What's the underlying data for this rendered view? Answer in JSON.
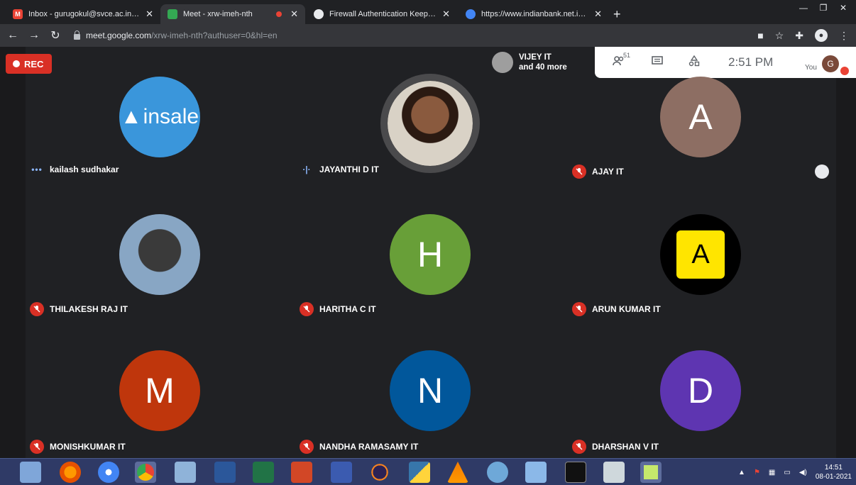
{
  "browser": {
    "tabs": [
      {
        "title": "Inbox - gurugokul@svce.ac.in - S",
        "favicon_color": "#ea4335",
        "active": false
      },
      {
        "title": "Meet - xrw-imeh-nth",
        "favicon_color": "#34a853",
        "active": true
      },
      {
        "title": "Firewall Authentication Keepalive",
        "favicon_color": "#e8eaed",
        "active": false
      },
      {
        "title": "https://www.indianbank.net.in/jsp",
        "favicon_color": "#4285f4",
        "active": false
      }
    ],
    "url_host": "meet.google.com",
    "url_path": "/xrw-imeh-nth?authuser=0&hl=en"
  },
  "meet": {
    "rec_label": "REC",
    "raised_hand_names": "VIJEY IT",
    "raised_hand_more": "and 40 more",
    "participants_count": "51",
    "clock": "2:51 PM",
    "self_label": "You",
    "self_initial": "G",
    "participants": [
      {
        "name": "kailash sudhakar",
        "avatar_text": "insale",
        "status": "dots",
        "color": "#3a96db"
      },
      {
        "name": "JAYANTHI D IT",
        "avatar_text": "",
        "status": "speaking",
        "color": "#b0a08a"
      },
      {
        "name": "AJAY IT",
        "avatar_text": "A",
        "status": "muted",
        "color": "#8d6e63"
      },
      {
        "name": "THILAKESH RAJ IT",
        "avatar_text": "",
        "status": "muted",
        "color": "#6a8fb0"
      },
      {
        "name": "HARITHA C IT",
        "avatar_text": "H",
        "status": "muted",
        "color": "#689f38"
      },
      {
        "name": "ARUN KUMAR IT",
        "avatar_text": "A",
        "status": "muted",
        "color": "#000000"
      },
      {
        "name": "MONISHKUMAR IT",
        "avatar_text": "M",
        "status": "muted",
        "color": "#bf360c"
      },
      {
        "name": "NANDHA RAMASAMY IT",
        "avatar_text": "N",
        "status": "muted",
        "color": "#01579b"
      },
      {
        "name": "DHARSHAN V IT",
        "avatar_text": "D",
        "status": "muted",
        "color": "#5e35b1"
      }
    ]
  },
  "taskbar": {
    "time": "14:51",
    "date": "08-01-2021"
  }
}
